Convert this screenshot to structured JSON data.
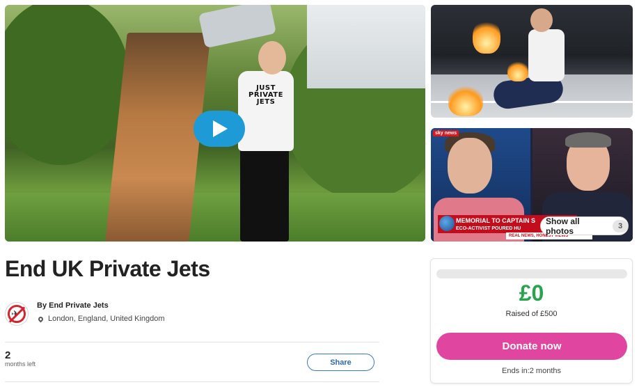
{
  "gallery": {
    "hero_shirt_text": "JUST PRIVATE JETS",
    "news_logo": "sky news",
    "news_ticker": "MEMORIAL TO CAPTAIN S",
    "news_ticker_sub": "ECO-ACTIVIST POURED HU",
    "news_strap": "REAL NEWS, HONEST VIEWS",
    "show_all_label": "Show all photos",
    "photo_count": "3",
    "play_icon": "play-icon"
  },
  "campaign": {
    "title": "End UK Private Jets",
    "organizer": "By End Private Jets",
    "location": "London, England, United Kingdom",
    "time_left_value": "2",
    "time_left_label": "months left",
    "share_label": "Share"
  },
  "donation": {
    "raised": "£0",
    "raised_of": "Raised of £500",
    "progress_fraction": 0,
    "donate_label": "Donate now",
    "ends": "Ends in:2 months",
    "accent_green": "#2aa34f",
    "accent_pink": "#e046a0"
  }
}
